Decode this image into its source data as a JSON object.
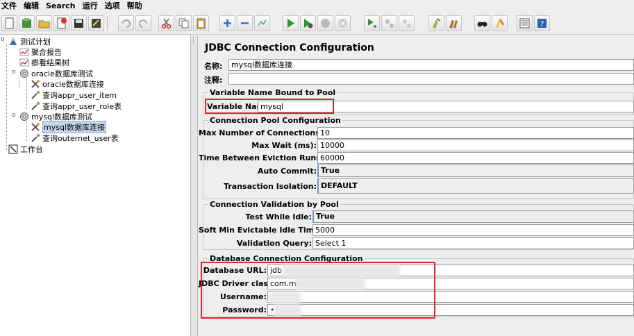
{
  "menu": [
    "文件",
    "编辑",
    "Search",
    "运行",
    "选项",
    "帮助"
  ],
  "tree": {
    "root": "测试计划",
    "items": {
      "aggregate": "聚合报告",
      "results_tree": "察看结果树",
      "oracle_group": "oracle数据库测试",
      "oracle_conn": "oracle数据库连接",
      "oracle_q1": "查询appr_user_item",
      "oracle_q2": "查询appr_user_role表",
      "mysql_group": "mysql数据库测试",
      "mysql_conn": "mysql数据库连接",
      "mysql_q1": "查询outernet_user表",
      "workbench": "工作台"
    }
  },
  "panel": {
    "title": "JDBC Connection Configuration",
    "name_label": "名称:",
    "name_value": "mysql数据库连接",
    "comment_label": "注释:",
    "comment_value": "",
    "pool_group": "Variable Name Bound to Pool",
    "variable_label": "Variable Name:",
    "variable_value": "mysql",
    "conn_pool_group": "Connection Pool Configuration",
    "max_conn_label": "Max Number of Connections:",
    "max_conn_value": "10",
    "max_wait_label": "Max Wait (ms):",
    "max_wait_value": "10000",
    "eviction_label": "Time Between Eviction Runs (ms):",
    "eviction_value": "60000",
    "auto_commit_label": "Auto Commit:",
    "auto_commit_value": "True",
    "isolation_label": "Transaction Isolation:",
    "isolation_value": "DEFAULT",
    "validation_group": "Connection Validation by Pool",
    "test_idle_label": "Test While Idle:",
    "test_idle_value": "True",
    "soft_min_label": "Soft Min Evictable Idle Time(ms):",
    "soft_min_value": "5000",
    "validation_query_label": "Validation Query:",
    "validation_query_value": "Select 1",
    "db_group": "Database Connection Configuration",
    "db_url_label": "Database URL:",
    "db_url_value": "jdb",
    "driver_label": "JDBC Driver class:",
    "driver_value": "com.mys",
    "username_label": "Username:",
    "username_value": "",
    "password_label": "Password:",
    "password_value": "•"
  },
  "colors": {
    "highlight": "#e0262b",
    "selection": "#c7d7ec"
  }
}
